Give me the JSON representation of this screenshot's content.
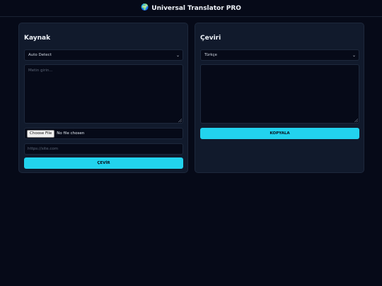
{
  "header": {
    "title": "Universal Translator PRO",
    "globe": "🌍"
  },
  "source": {
    "title": "Kaynak",
    "language": "Auto Detect",
    "text_placeholder": "Metin girin...",
    "file_button": "Choose File",
    "file_status": "No file chosen",
    "url_placeholder": "https://site.com",
    "translate_button": "ÇEVİR"
  },
  "target": {
    "title": "Çeviri",
    "language": "Türkçe",
    "copy_button": "KOPYALA"
  },
  "colors": {
    "accent": "#22d3ee",
    "background": "#060a18",
    "panel": "#111a2c"
  }
}
